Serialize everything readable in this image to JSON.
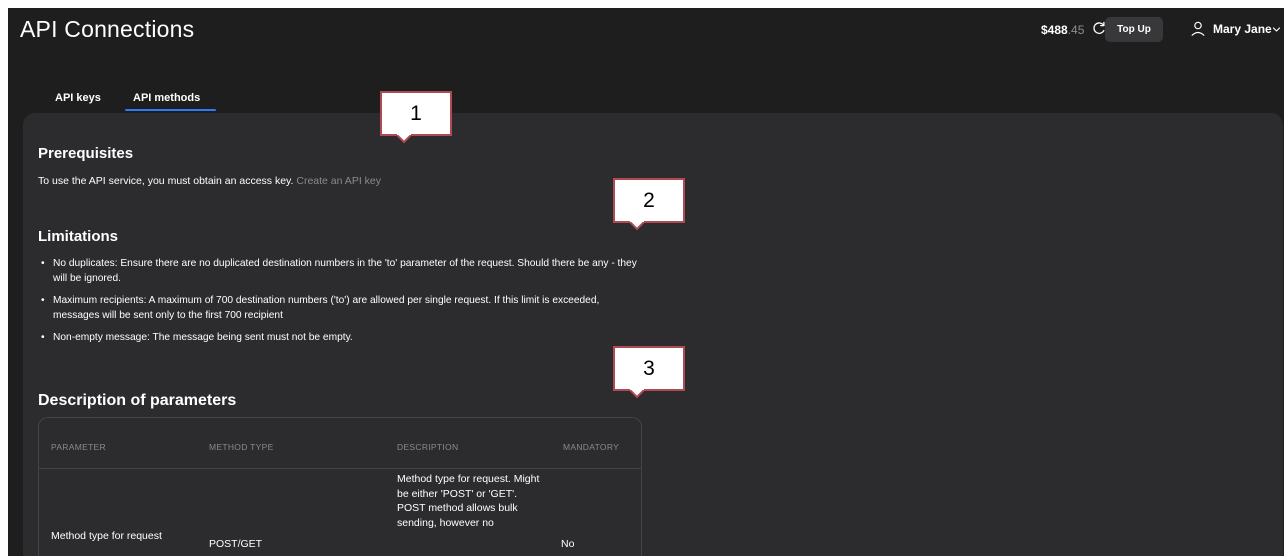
{
  "header": {
    "title": "API Connections",
    "balance_main": "$488",
    "balance_cents": ".45",
    "topup_label": "Top Up",
    "user_name": "Mary Jane"
  },
  "tabs": [
    {
      "label": "API keys",
      "active": false
    },
    {
      "label": "API methods",
      "active": true
    }
  ],
  "prerequisites": {
    "heading": "Prerequisites",
    "text": "To use the API service, you must obtain an access key.",
    "link": "Create an API key"
  },
  "limitations": {
    "heading": "Limitations",
    "items": [
      "No duplicates: Ensure there are no duplicated destination numbers in the 'to' parameter of the request. Should there be any - they will be ignored.",
      "Maximum recipients: A maximum of 700 destination numbers ('to') are allowed per single request. If this limit is exceeded, messages will be sent only to the first 700 recipient",
      "Non-empty message: The message being sent must not be empty."
    ]
  },
  "parameters": {
    "heading": "Description of parameters",
    "columns": [
      "PARAMETER",
      "METHOD TYPE",
      "DESCRIPTION",
      "MANDATORY"
    ],
    "rows": [
      {
        "parameter": "Method type for request",
        "method_type": "POST/GET",
        "description": "Method type for request. Might be either 'POST' or 'GET'. POST method allows bulk sending, however no",
        "mandatory": "No"
      }
    ]
  },
  "callouts": [
    "1",
    "2",
    "3"
  ],
  "colors": {
    "background": "#1e1e1f",
    "panel": "#2c2c2e",
    "accent": "#2f7bf5",
    "muted_text": "#8a8a8a",
    "callout_border": "#b04a52"
  },
  "icons": [
    "refresh-icon",
    "user-icon",
    "chevron-down-icon"
  ]
}
